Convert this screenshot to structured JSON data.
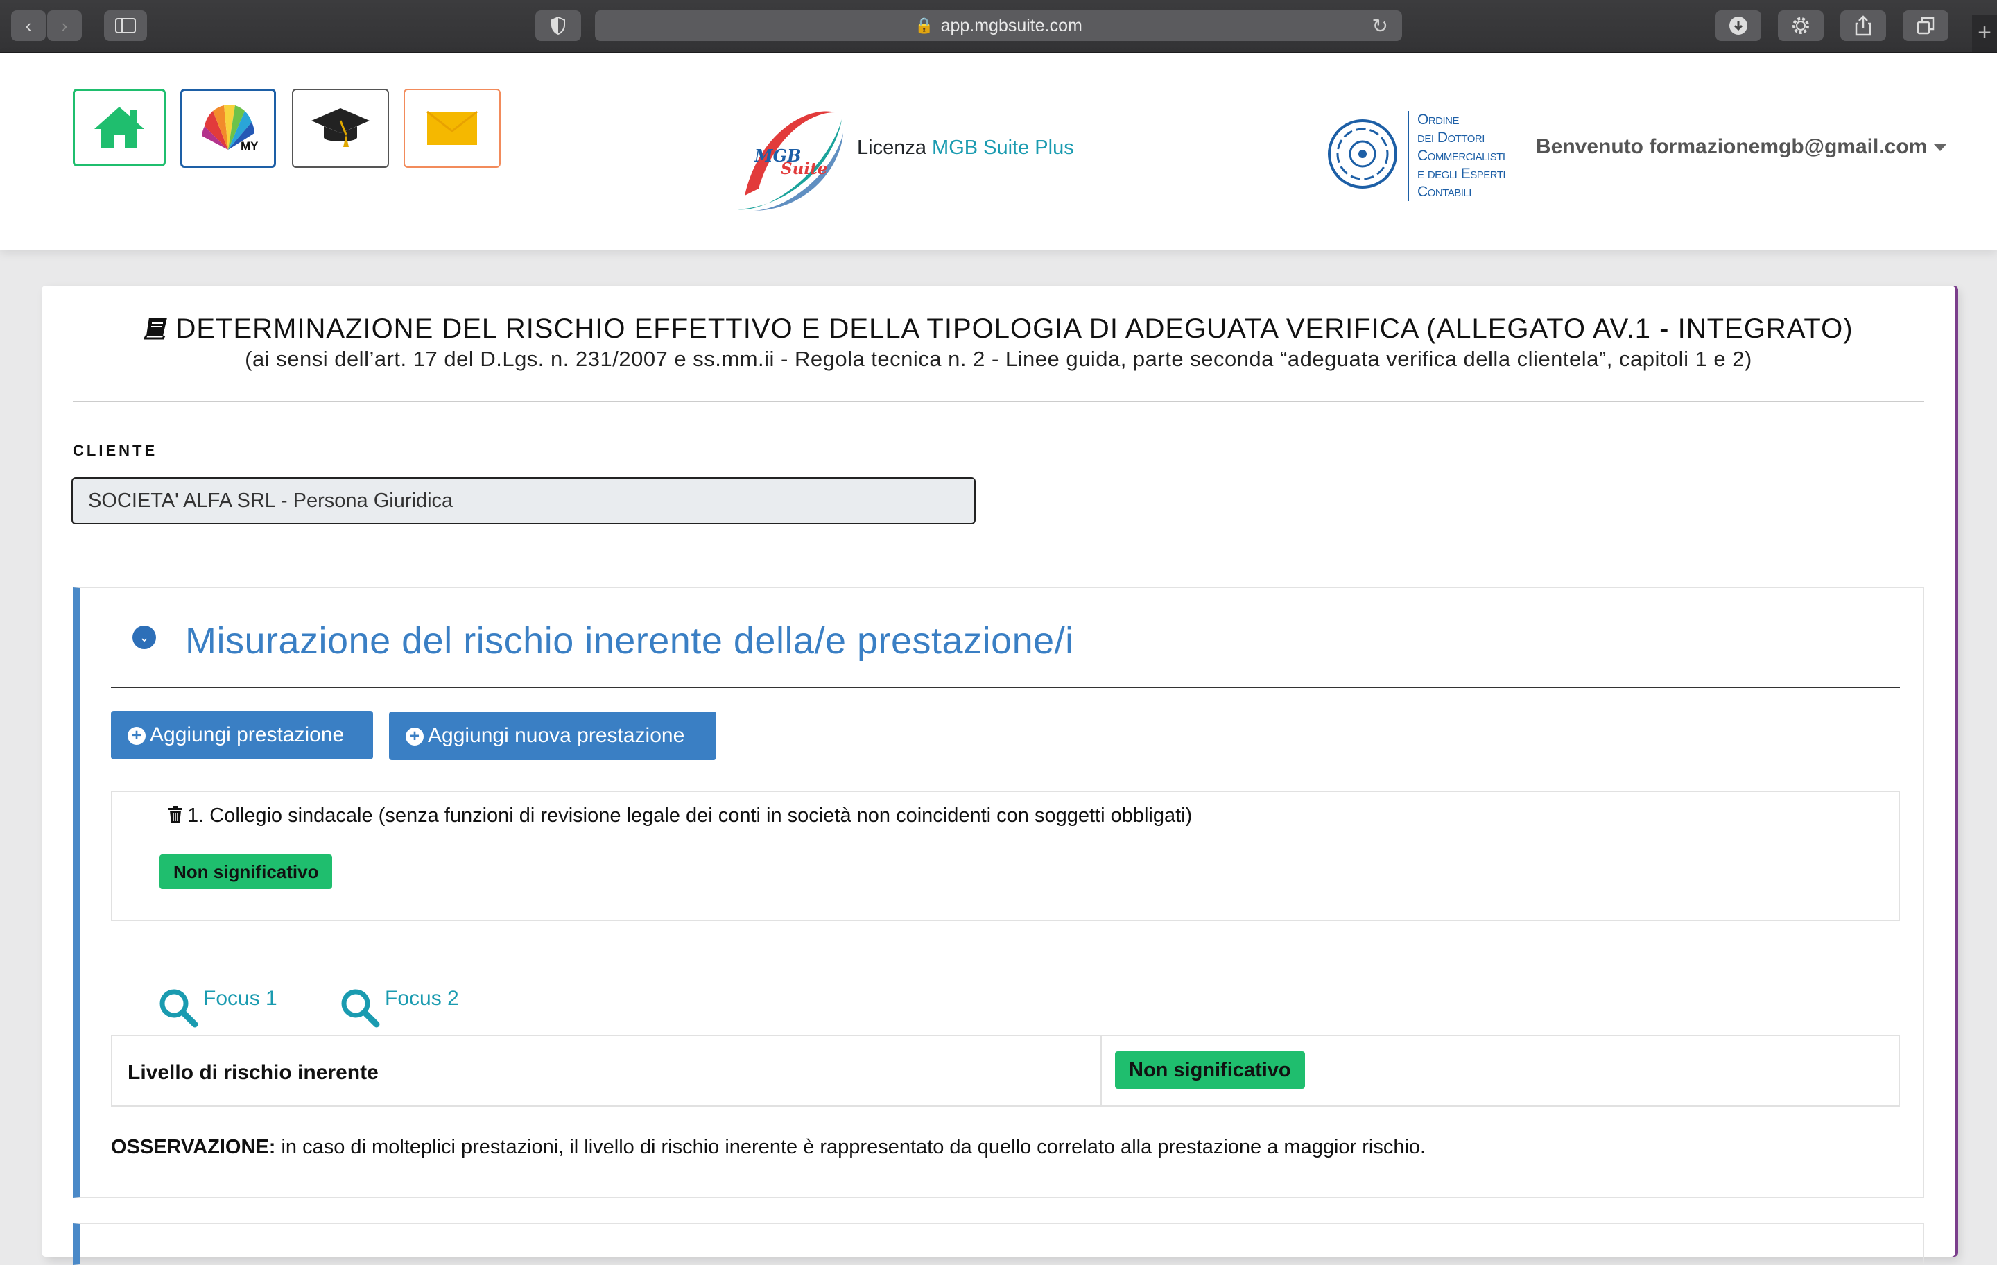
{
  "browser": {
    "url": "app.mgbsuite.com"
  },
  "header": {
    "tiles": {
      "my_label": "MY"
    },
    "logo": {
      "line1": "MGB",
      "line2": "Suite"
    },
    "licenza_prefix": "Licenza",
    "licenza_name": "MGB Suite Plus",
    "ordine": {
      "line1": "Ordine",
      "line2": "dei Dottori",
      "line3": "Commercialisti",
      "line4": "e degli Esperti",
      "line5": "Contabili"
    },
    "welcome": "Benvenuto formazionemgb@gmail.com"
  },
  "page": {
    "title": "DETERMINAZIONE DEL RISCHIO EFFETTIVO E DELLA TIPOLOGIA DI ADEGUATA VERIFICA (ALLEGATO AV.1 - INTEGRATO)",
    "subtitle": "(ai sensi dell’art. 17 del D.Lgs. n. 231/2007 e ss.mm.ii - Regola tecnica n. 2 - Linee guida, parte seconda “adeguata verifica della clientela”, capitoli 1 e 2)",
    "cliente_label": "CLIENTE",
    "cliente_value": "SOCIETA' ALFA SRL - Persona Giuridica"
  },
  "section": {
    "title": "Misurazione del rischio inerente della/e prestazione/i",
    "buttons": {
      "aggiungi": "Aggiungi prestazione",
      "aggiungi_nuova": "Aggiungi nuova prestazione"
    },
    "prestazione": {
      "text": "1. Collegio sindacale (senza funzioni di revisione legale dei conti in società non coincidenti con soggetti obbligati)",
      "badge": "Non significativo"
    },
    "focus1": "Focus 1",
    "focus2": "Focus 2",
    "livello_label": "Livello di rischio inerente",
    "livello_value": "Non significativo",
    "osservazione_label": "OSSERVAZIONE:",
    "osservazione_text": " in caso di molteplici prestazioni, il livello di rischio inerente è rappresentato da quello correlato alla prestazione a maggior rischio."
  },
  "colors": {
    "accent_blue": "#3a7fc4",
    "teal": "#1a9bb0",
    "badge_green": "#1fbe6e",
    "section_border": "#4a89c8"
  }
}
